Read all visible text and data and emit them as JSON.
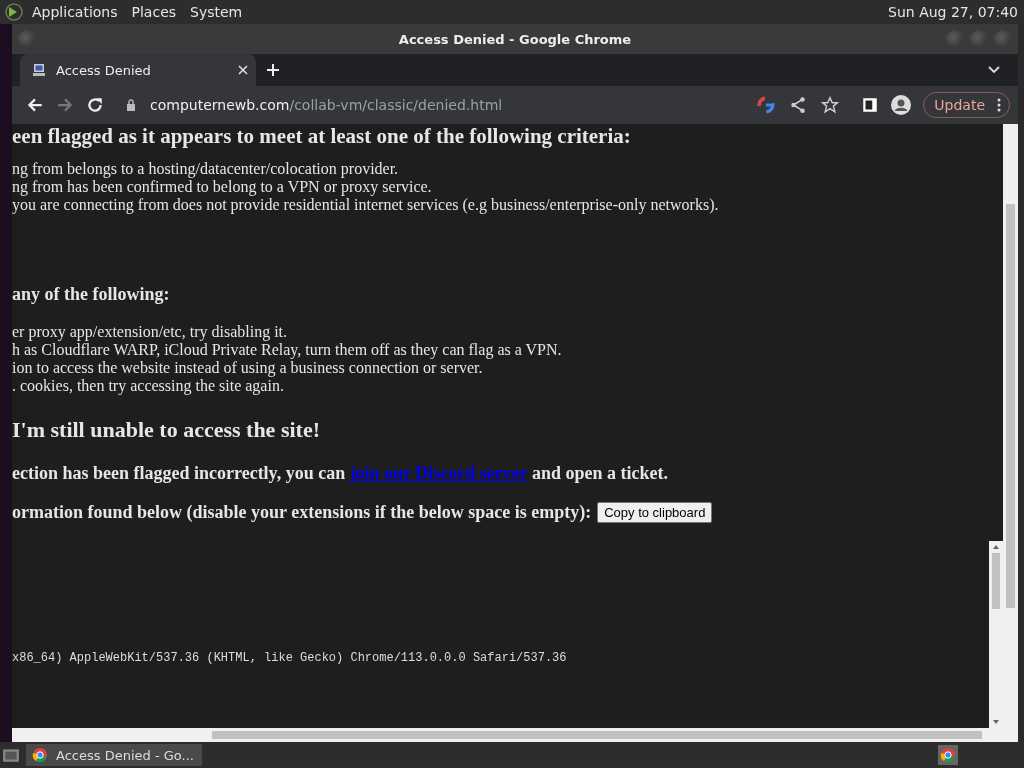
{
  "top_panel": {
    "menus": [
      "Applications",
      "Places",
      "System"
    ],
    "clock": "Sun Aug 27, 07:40"
  },
  "window": {
    "title": "Access Denied - Google Chrome",
    "tabs": [
      {
        "label": "Access Denied",
        "selected": true
      }
    ],
    "address": {
      "domain": "computernewb.com",
      "path": "/collab-vm/classic/denied.html"
    },
    "update_button": "Update"
  },
  "page": {
    "heading_top": "een flagged as it appears to meet at least one of the following criteria:",
    "criteria": [
      "ng from belongs to a hosting/datacenter/colocation provider.",
      "ng from has been confirmed to belong to a VPN or proxy service.",
      "you are connecting from does not provide residential internet services (e.g business/enterprise-only networks)."
    ],
    "fixes_heading": "any of the following:",
    "fixes": [
      "er proxy app/extension/etc, try disabling it.",
      "h as Cloudflare WARP, iCloud Private Relay, turn them off as they can flag as a VPN.",
      "ion to access the website instead of using a business connection or server.",
      ". cookies, then try accessing the site again."
    ],
    "still_heading": "I'm still unable to access the site!",
    "ticket": {
      "before": "ection has been flagged incorrectly, you can ",
      "link": "join our Discord server",
      "after": " and open a ticket."
    },
    "info": {
      "label": "ormation found below (disable your extensions if the below space is empty):",
      "button": "Copy to clipboard"
    },
    "user_agent": "x86_64) AppleWebKit/537.36 (KHTML, like Gecko) Chrome/113.0.0.0 Safari/537.36"
  },
  "taskbar": {
    "tasks": [
      {
        "label": "Access Denied - Go...",
        "selected": true
      }
    ]
  }
}
